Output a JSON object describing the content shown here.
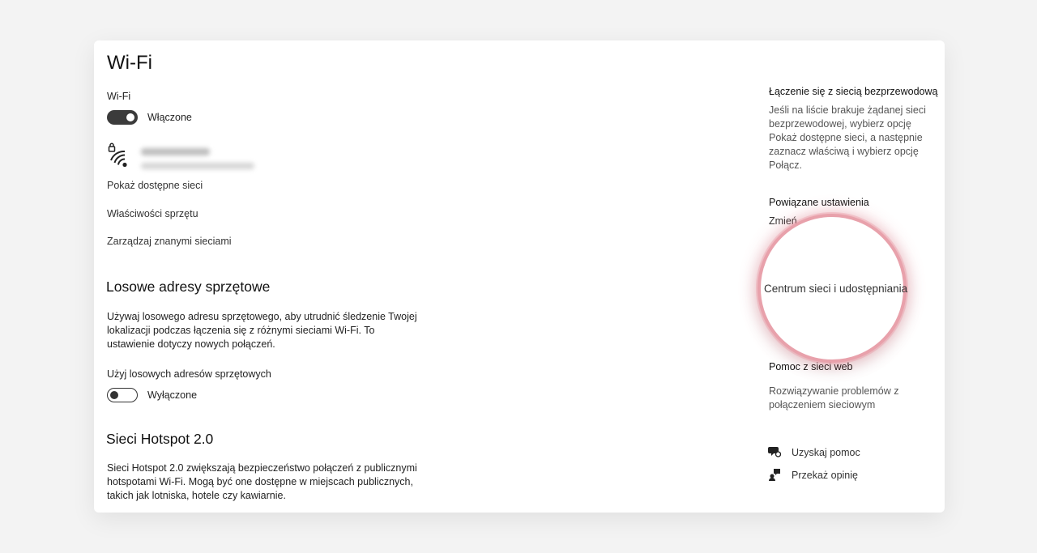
{
  "window": {
    "title": "Wi-Fi"
  },
  "wifi": {
    "section_label": "Wi-Fi",
    "toggle_state": "Włączone",
    "toggle_on": true
  },
  "network": {
    "icon": "wifi-secured-icon"
  },
  "links": {
    "show_networks": "Pokaż dostępne sieci",
    "hardware_props": "Właściwości sprzętu",
    "manage_known": "Zarządzaj znanymi sieciami"
  },
  "random_hw": {
    "heading": "Losowe adresy sprzętowe",
    "description": "Używaj losowego adresu sprzętowego, aby utrudnić śledzenie Twojej lokalizacji podczas łączenia się z różnymi sieciami Wi-Fi. To ustawienie dotyczy nowych połączeń.",
    "toggle_label": "Użyj losowych adresów sprzętowych",
    "toggle_state": "Wyłączone",
    "toggle_on": false
  },
  "hotspot": {
    "heading": "Sieci Hotspot 2.0",
    "description": "Sieci Hotspot 2.0 zwiększają bezpieczeństwo połączeń z publicznymi hotspotami Wi-Fi. Mogą być one dostępne w miejscach publicznych, takich jak lotniska, hotele czy kawiarnie."
  },
  "sidebar": {
    "wireless_heading": "Łączenie się z siecią bezprzewodową",
    "wireless_text": "Jeśli na liście brakuje żądanej sieci bezprzewodowej, wybierz opcję Pokaż dostępne sieci, a następnie zaznacz właściwą i wybierz opcję Połącz.",
    "related_heading": "Powiązane ustawienia",
    "related_partial": "Zmień",
    "highlighted_link": "Centrum sieci i udostępniania",
    "help_heading": "Pomoc z sieci web",
    "help_link": "Rozwiązywanie problemów z połączeniem sieciowym",
    "get_help": "Uzyskaj pomoc",
    "feedback": "Przekaż opinię"
  },
  "colors": {
    "highlight_ring": "#e8a1ab",
    "toggle_on": "#3b3b3b"
  }
}
